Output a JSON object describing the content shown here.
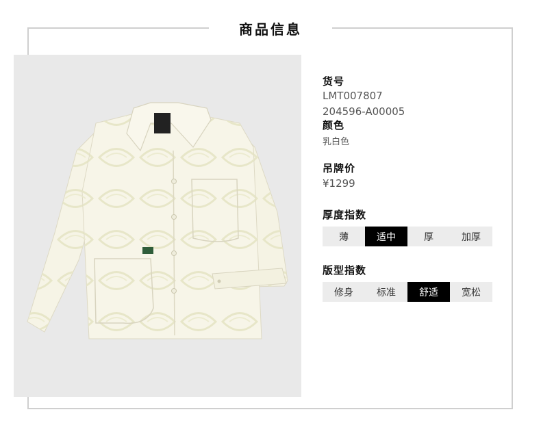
{
  "header": {
    "title": "商品信息"
  },
  "product": {
    "image_name": "jacket-photo",
    "sku_label": "货号",
    "sku_values": [
      "LMT007807",
      "204596-A00005"
    ],
    "color_label": "颜色",
    "color_value": "乳白色",
    "price_label": "吊牌价",
    "price_value": "¥1299"
  },
  "thickness": {
    "label": "厚度指数",
    "options": [
      "薄",
      "适中",
      "厚",
      "加厚"
    ],
    "selected_index": 1
  },
  "fit": {
    "label": "版型指数",
    "options": [
      "修身",
      "标准",
      "舒适",
      "宽松"
    ],
    "selected_index": 2
  },
  "colors": {
    "selected_bg": "#000000",
    "selected_fg": "#ffffff",
    "unselected_bg": "#ececec",
    "border": "#cfcfcf"
  }
}
